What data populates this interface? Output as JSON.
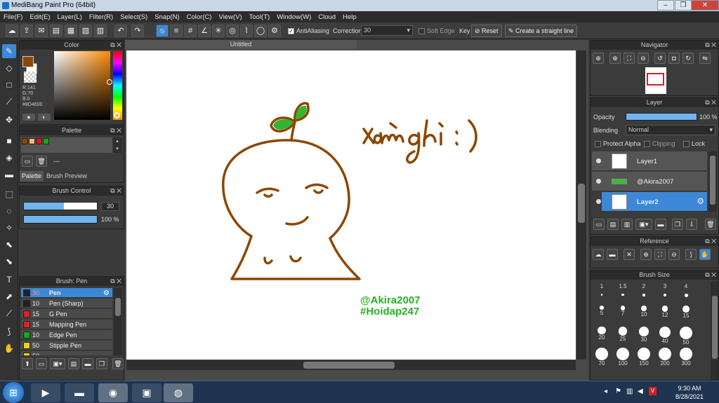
{
  "window": {
    "title": "MediBang Paint Pro (64bit)"
  },
  "menu": [
    "File(F)",
    "Edit(E)",
    "Layer(L)",
    "Filter(R)",
    "Select(S)",
    "Snap(N)",
    "Color(C)",
    "View(V)",
    "Tool(T)",
    "Window(W)",
    "Cloud",
    "Help"
  ],
  "toolbar": {
    "antialias_label": "AntiAliasing",
    "correction_label": "Correction",
    "correction_value": "30",
    "softedge_label": "Soft Edge",
    "key_label": "Key",
    "reset_label": "Reset",
    "straight_label": "Create a straight line"
  },
  "color_panel": {
    "title": "Color",
    "r": "R:141",
    "g": "G:70",
    "b": "B:0",
    "hex": "#8D4600",
    "fg": "#8D4600",
    "bg": "#ffffff"
  },
  "palette_panel": {
    "title": "Palette",
    "swatches": [
      "#8d4600",
      "#f3b48a",
      "#d81818",
      "#18a818"
    ],
    "dash": "---",
    "tab_palette": "Palette",
    "tab_preview": "Brush Preview"
  },
  "brush_control": {
    "title": "Brush Control",
    "size": "30",
    "opacity": "100 %",
    "size_fraction": 0.55,
    "opacity_fraction": 1.0
  },
  "brush_panel": {
    "title": "Brush: Pen",
    "items": [
      {
        "size": "30",
        "name": "Pen",
        "color": "#222222"
      },
      {
        "size": "10",
        "name": "Pen (Sharp)",
        "color": "#222222"
      },
      {
        "size": "15",
        "name": "G Pen",
        "color": "#e02020"
      },
      {
        "size": "15",
        "name": "Mapping Pen",
        "color": "#e02020"
      },
      {
        "size": "10",
        "name": "Edge Pen",
        "color": "#18a818"
      },
      {
        "size": "50",
        "name": "Stipple Pen",
        "color": "#e8d020"
      },
      {
        "size": "50",
        "name": "",
        "color": "#e8d020"
      }
    ]
  },
  "document": {
    "tab": "Untitled",
    "text_title": "Xàm ghi :)",
    "credit1": "@Akira2007",
    "credit2": "#Hoidap247",
    "ink": "#8D4600",
    "credit_color": "#22b422"
  },
  "navigator": {
    "title": "Navigator"
  },
  "layer_panel": {
    "title": "Layer",
    "opacity_label": "Opacity",
    "opacity_value": "100 %",
    "opacity_fraction": 1.0,
    "blending_label": "Blending",
    "blending_value": "Normal",
    "protect_alpha": "Protect Alpha",
    "clipping": "Clipping",
    "lock": "Lock",
    "layers": [
      "Layer1",
      "@Akira2007",
      "Layer2"
    ]
  },
  "reference_panel": {
    "title": "Reference"
  },
  "brush_size_panel": {
    "title": "Brush Size",
    "sizes": [
      "1",
      "1.5",
      "2",
      "3",
      "4",
      "5",
      "7",
      "10",
      "12",
      "15",
      "20",
      "25",
      "30",
      "40",
      "50",
      "70",
      "100",
      "150",
      "200",
      "300"
    ]
  },
  "taskbar": {
    "time": "9:30 AM",
    "date": "8/28/2021"
  }
}
